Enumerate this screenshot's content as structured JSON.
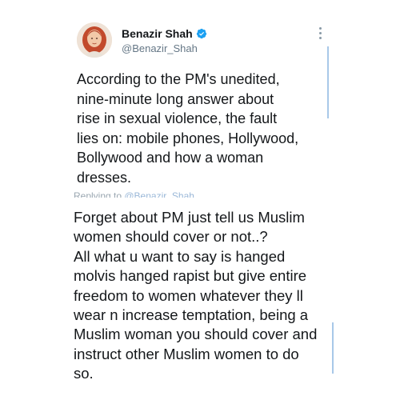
{
  "tweet": {
    "author_name": "Benazir Shah",
    "author_handle": "@Benazir_Shah",
    "verified_icon": "verified-badge-icon",
    "more_icon": "more-vertical-icon",
    "avatar_icon": "profile-avatar",
    "text": "According to the PM's unedited,\nnine-minute long answer about\nrise in sexual violence, the fault\nlies on:  mobile phones, Hollywood,\nBollywood and how a woman\ndresses."
  },
  "reply": {
    "replying_prefix": "Replying to ",
    "replying_handle": "@Benazir_Shah",
    "text": "Forget about PM just tell us Muslim\nwomen should cover or not..?\nAll what u want to say is hanged\nmolvis hanged rapist but give entire\nfreedom to women whatever they ll\nwear n increase temptation, being a\nMuslim woman you should cover and\ninstruct other Muslim women to do\nso."
  },
  "colors": {
    "verified": "#1da1f2",
    "handle": "#657786",
    "text": "#14171a",
    "scroll_accent": "#a8c8e8"
  }
}
